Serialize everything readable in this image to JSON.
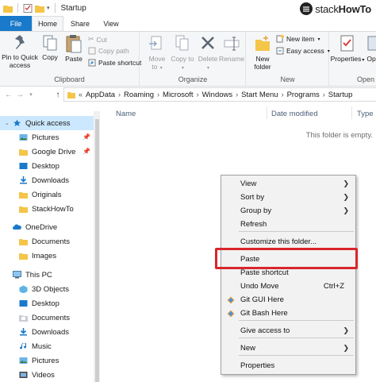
{
  "window": {
    "title": "Startup",
    "brand": {
      "text_light": "stack",
      "text_bold": "HowTo"
    }
  },
  "tabs": [
    {
      "label": "File"
    },
    {
      "label": "Home"
    },
    {
      "label": "Share"
    },
    {
      "label": "View"
    }
  ],
  "ribbon": {
    "clipboard": {
      "label": "Clipboard",
      "pin_to_quick_access": "Pin to Quick access",
      "copy": "Copy",
      "paste": "Paste",
      "cut": "Cut",
      "copy_path": "Copy path",
      "paste_shortcut": "Paste shortcut"
    },
    "organize": {
      "label": "Organize",
      "move_to": "Move to",
      "copy_to": "Copy to",
      "delete": "Delete",
      "rename": "Rename"
    },
    "new": {
      "label": "New",
      "new_folder": "New folder",
      "new_item": "New item",
      "easy_access": "Easy access"
    },
    "open": {
      "label": "Open",
      "properties": "Properties",
      "open_short": "Op"
    }
  },
  "address": {
    "crumbs": [
      "AppData",
      "Roaming",
      "Microsoft",
      "Windows",
      "Start Menu",
      "Programs",
      "Startup"
    ]
  },
  "nav": {
    "quick_access": "Quick access",
    "quick_items": [
      {
        "label": "Pictures",
        "pinned": true,
        "icon": "pictures-icon"
      },
      {
        "label": "Google Drive",
        "pinned": true,
        "icon": "folder-icon"
      },
      {
        "label": "Desktop",
        "pinned": false,
        "icon": "desktop-icon"
      },
      {
        "label": "Downloads",
        "pinned": false,
        "icon": "downloads-icon"
      },
      {
        "label": "Originals",
        "pinned": false,
        "icon": "folder-icon"
      },
      {
        "label": "StackHowTo",
        "pinned": false,
        "icon": "folder-icon"
      }
    ],
    "onedrive": "OneDrive",
    "onedrive_items": [
      {
        "label": "Documents",
        "icon": "folder-icon"
      },
      {
        "label": "Images",
        "icon": "folder-icon"
      }
    ],
    "this_pc": "This PC",
    "pc_items": [
      {
        "label": "3D Objects",
        "icon": "3d-objects-icon"
      },
      {
        "label": "Desktop",
        "icon": "desktop-icon"
      },
      {
        "label": "Documents",
        "icon": "documents-icon"
      },
      {
        "label": "Downloads",
        "icon": "downloads-icon"
      },
      {
        "label": "Music",
        "icon": "music-icon"
      },
      {
        "label": "Pictures",
        "icon": "pictures-icon"
      },
      {
        "label": "Videos",
        "icon": "videos-icon"
      }
    ]
  },
  "content": {
    "columns": [
      "Name",
      "Date modified",
      "Type"
    ],
    "empty_message": "This folder is empty."
  },
  "context_menu": {
    "items": [
      {
        "label": "View",
        "submenu": true
      },
      {
        "label": "Sort by",
        "submenu": true
      },
      {
        "label": "Group by",
        "submenu": true
      },
      {
        "label": "Refresh"
      },
      {
        "label": "Customize this folder..."
      },
      {
        "label": "Paste"
      },
      {
        "label": "Paste shortcut"
      },
      {
        "label": "Undo Move",
        "shortcut": "Ctrl+Z"
      },
      {
        "label": "Git GUI Here",
        "icon": "git-icon"
      },
      {
        "label": "Git Bash Here",
        "icon": "git-icon"
      },
      {
        "label": "Give access to",
        "submenu": true
      },
      {
        "label": "New",
        "submenu": true
      },
      {
        "label": "Properties"
      }
    ]
  },
  "colors": {
    "accent": "#1979ca",
    "selection": "#cce8ff",
    "highlight_border": "#d8262b",
    "folder": "#f4c549"
  }
}
